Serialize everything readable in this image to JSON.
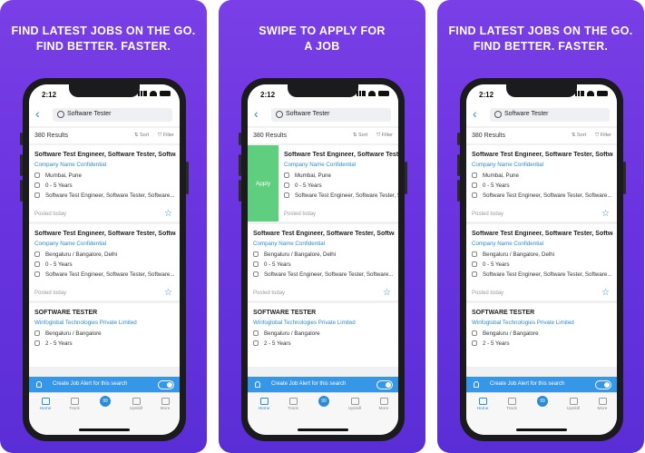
{
  "panels": [
    {
      "headline": [
        "FIND LATEST JOBS ON THE GO.",
        "FIND BETTER. FASTER."
      ],
      "swiped": false
    },
    {
      "headline": [
        "SWIPE TO APPLY FOR",
        "A JOB"
      ],
      "swiped": true
    },
    {
      "headline": [
        "FIND LATEST JOBS ON THE GO.",
        "FIND BETTER. FASTER."
      ],
      "swiped": false
    }
  ],
  "status": {
    "time": "2:12"
  },
  "search": {
    "query": "Software Tester"
  },
  "results": {
    "count": "380 Results",
    "sort": "Sort",
    "filter": "Filter"
  },
  "apply_label": "Apply",
  "jobs": [
    {
      "title": "Software Test Engineer, Software Tester, Softwa...",
      "company": "Company Name Confidential",
      "location": "Mumbai, Pune",
      "experience": "0 - 5 Years",
      "skills": "Software Test Engineer, Software Tester, Software...",
      "posted": "Posted today"
    },
    {
      "title": "Software Test Engineer, Software Tester, Softwa...",
      "company": "Company Name Confidential",
      "location": "Bengaluru / Bangalore, Delhi",
      "experience": "0 - 5 Years",
      "skills": "Software Test Engineer, Software Tester, Software...",
      "posted": "Posted today"
    },
    {
      "title": "SOFTWARE TESTER",
      "company": "Winfoglobal Technologies Private Limited",
      "location": "Bengaluru / Bangalore",
      "experience": "2 - 5 Years"
    }
  ],
  "alert": {
    "text": "Create Job Alert for this search"
  },
  "tabs": [
    {
      "label": "Home",
      "active": true
    },
    {
      "label": "Track"
    },
    {
      "label": "",
      "badge": "99"
    },
    {
      "label": "Upskill"
    },
    {
      "label": "More"
    }
  ],
  "colors": {
    "gradient_top": "#7a3fe6",
    "gradient_bottom": "#5a2ed6",
    "accent": "#2b8bd6",
    "apply_green": "#5fcf7f",
    "alert_blue": "#3696e8"
  }
}
